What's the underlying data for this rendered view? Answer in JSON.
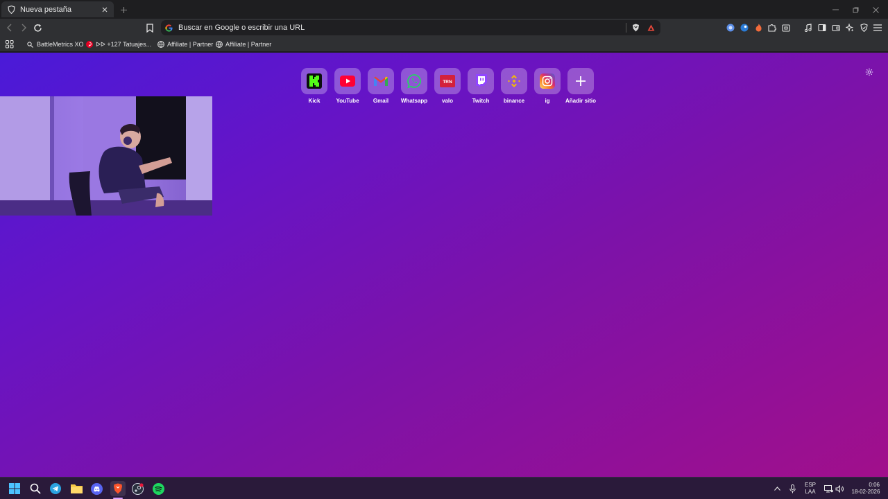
{
  "browser": {
    "tab": {
      "title": "Nueva pestaña",
      "icon": "brave-shield-icon"
    },
    "omnibox": {
      "placeholder": "Buscar en Google o escribir una URL"
    },
    "bookmarks": [
      {
        "label": "BattleMetrics XO",
        "icon": "search-icon"
      },
      {
        "label": "ᐅᐅ +127 Tatuajes...",
        "icon": "pinterest-icon"
      },
      {
        "label": "Affiliate | Partner",
        "icon": "globe-icon"
      },
      {
        "label": "Affiliate | Partner",
        "icon": "globe-icon"
      }
    ]
  },
  "newtab": {
    "tiles": [
      {
        "label": "Kick",
        "icon": "kick-icon",
        "color": "#53fc18"
      },
      {
        "label": "YouTube",
        "icon": "youtube-icon",
        "color": "#ff0033"
      },
      {
        "label": "Gmail",
        "icon": "gmail-icon",
        "color": "#ea4335"
      },
      {
        "label": "Whatsapp",
        "icon": "whatsapp-icon",
        "color": "#25d366"
      },
      {
        "label": "valo",
        "icon": "trn-icon",
        "color": "#d3213b"
      },
      {
        "label": "Twitch",
        "icon": "twitch-icon",
        "color": "#9146ff"
      },
      {
        "label": "binance",
        "icon": "binance-icon",
        "color": "#f0b90b"
      },
      {
        "label": "ig",
        "icon": "instagram-icon",
        "color": "#e1306c"
      },
      {
        "label": "Añadir sitio",
        "icon": "plus-icon",
        "color": "#ffffff"
      }
    ]
  },
  "taskbar": {
    "language": {
      "line1": "ESP",
      "line2": "LAA"
    },
    "clock": {
      "time": "0:06",
      "date": "18-02-2026"
    }
  }
}
